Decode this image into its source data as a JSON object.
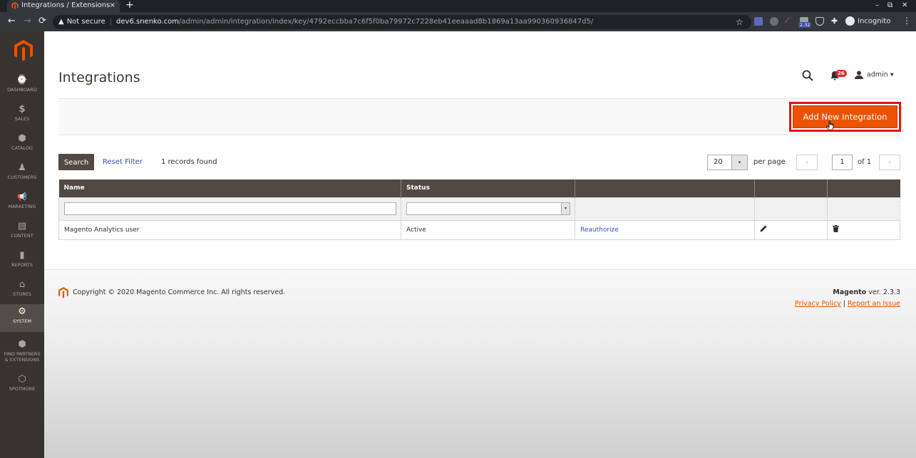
{
  "browser": {
    "tab_title": "Integrations / Extensions",
    "tab_close": "×",
    "new_tab": "+",
    "url_warning": "Not secure",
    "url_host": "dev6.snenko.com",
    "url_path": "/admin/admin/integration/index/key/4792eccbba7c6f5f0ba79972c7228eb41eeaaad8b1869a13aa990360936847d5/",
    "extension_badge": "2.32",
    "incognito_label": "Incognito",
    "minimize": "–",
    "restore": "⧉",
    "close": "✕",
    "back": "←",
    "forward": "→",
    "reload": "⟳",
    "star": "☆",
    "menu": "⋮"
  },
  "sidebar": {
    "items": [
      {
        "label": "DASHBOARD",
        "icon": "⌚"
      },
      {
        "label": "SALES",
        "icon": "$"
      },
      {
        "label": "CATALOG",
        "icon": "⬢"
      },
      {
        "label": "CUSTOMERS",
        "icon": "♟"
      },
      {
        "label": "MARKETING",
        "icon": "📢"
      },
      {
        "label": "CONTENT",
        "icon": "▤"
      },
      {
        "label": "REPORTS",
        "icon": "▮"
      },
      {
        "label": "STORES",
        "icon": "⌂"
      },
      {
        "label": "SYSTEM",
        "icon": "⚙"
      },
      {
        "label_line1": "FIND PARTNERS",
        "label_line2": "& EXTENSIONS",
        "icon": "⬢"
      },
      {
        "label": "SPOTMORE",
        "icon": "⬡"
      }
    ],
    "active": "SYSTEM"
  },
  "header": {
    "title": "Integrations",
    "notifications_count": "26",
    "user": "admin",
    "user_caret": "▾"
  },
  "actions": {
    "add_button": "Add New Integration"
  },
  "toolbar": {
    "search_button": "Search",
    "reset_filter": "Reset Filter",
    "records_found": "1 records found",
    "per_page_value": "20",
    "per_page_label": "per page",
    "page_value": "1",
    "page_of": "of 1",
    "prev": "‹",
    "next": "›",
    "select_arrow": "▾"
  },
  "grid": {
    "columns": [
      "Name",
      "Status",
      "",
      "",
      ""
    ],
    "rows": [
      {
        "name": "Magento Analytics user",
        "status": "Active",
        "action": "Reauthorize"
      }
    ]
  },
  "footer": {
    "copyright": "Copyright © 2020 Magento Commerce Inc. All rights reserved.",
    "brand": "Magento",
    "version": " ver. 2.3.3",
    "privacy": "Privacy Policy",
    "separator": " | ",
    "report": "Report an Issue"
  },
  "colors": {
    "accent": "#eb5202",
    "sidebar_bg": "#373330",
    "grid_header": "#514943",
    "link": "#3b4bbd"
  }
}
